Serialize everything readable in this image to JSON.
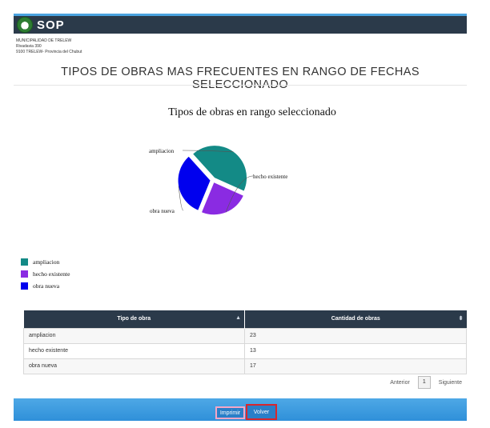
{
  "header": {
    "brand": "SOP"
  },
  "address": {
    "line1": "MUNICIPALIDAD DE TRELEW",
    "line2": "Rivadavia 390",
    "line3": "9100 TRELEW- Provincia del Chubut"
  },
  "page_title": "TIPOS DE OBRAS MAS FRECUENTES EN RANGO DE FECHAS SELECCIONADO",
  "chart_data": {
    "type": "pie",
    "title": "Tipos de obras en rango seleccionado",
    "categories": [
      "ampliacion",
      "hecho existente",
      "obra nueva"
    ],
    "values": [
      23,
      13,
      17
    ],
    "colors": [
      "#138a86",
      "#8a2be2",
      "#0000ee"
    ],
    "legend": "bottom-left"
  },
  "table": {
    "headers": [
      "Tipo de obra",
      "Cantidad de obras"
    ],
    "rows": [
      [
        "ampliacion",
        "23"
      ],
      [
        "hecho existente",
        "13"
      ],
      [
        "obra nueva",
        "17"
      ]
    ]
  },
  "pager": {
    "prev": "Anterior",
    "current": "1",
    "next": "Siguiente"
  },
  "buttons": {
    "print": "Imprimir",
    "back": "Volver"
  }
}
